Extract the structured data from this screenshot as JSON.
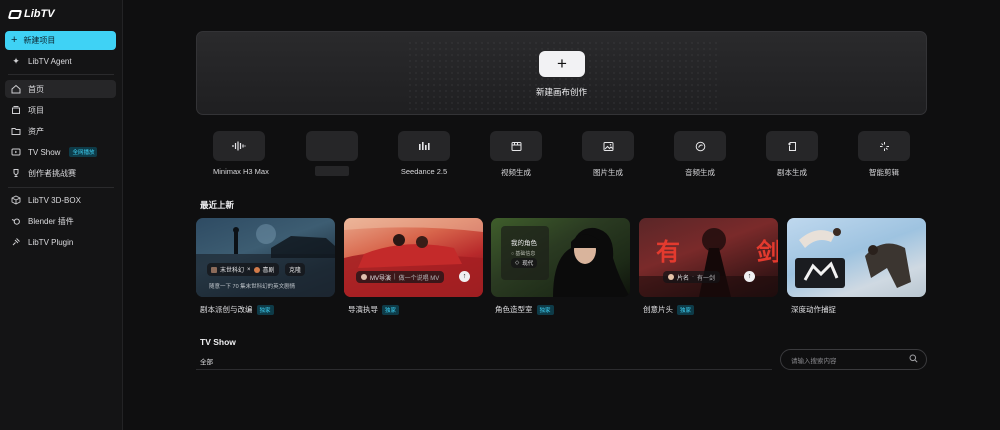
{
  "app": {
    "logo_text": "LibTV"
  },
  "sidebar": {
    "new_project": "新建项目",
    "items": [
      {
        "label": "LibTV Agent",
        "icon": "sparkle-icon"
      },
      {
        "label": "首页",
        "icon": "home-icon"
      },
      {
        "label": "项目",
        "icon": "stack-icon"
      },
      {
        "label": "资产",
        "icon": "folder-icon"
      },
      {
        "label": "TV Show",
        "icon": "tv-icon",
        "badge": "全网播放"
      },
      {
        "label": "创作者挑战赛",
        "icon": "trophy-icon"
      },
      {
        "label": "LibTV 3D-BOX",
        "icon": "cube-icon"
      },
      {
        "label": "Blender 插件",
        "icon": "blender-icon"
      },
      {
        "label": "LibTV Plugin",
        "icon": "plugin-icon"
      }
    ]
  },
  "hero": {
    "label": "新建画布创作",
    "plus": "+"
  },
  "tools": [
    {
      "label": "Minimax H3 Max",
      "icon": "waveform-icon"
    },
    {
      "label": "",
      "icon": ""
    },
    {
      "label": "Seedance 2.5",
      "icon": "bars-icon"
    },
    {
      "label": "视频生成",
      "icon": "video-icon"
    },
    {
      "label": "图片生成",
      "icon": "image-icon"
    },
    {
      "label": "音频生成",
      "icon": "audio-icon"
    },
    {
      "label": "剧本生成",
      "icon": "script-icon"
    },
    {
      "label": "智能剪辑",
      "icon": "cut-icon"
    }
  ],
  "recent": {
    "title": "最近上新",
    "cards": [
      {
        "caption": "剧本派创与改编",
        "badge": "独家",
        "chip1": "末世科幻",
        "chip2": "喜剧",
        "chip3": "克隆",
        "sub": "随意一下 70 集末世科幻的英文剧情"
      },
      {
        "caption": "导演执导",
        "badge": "独家",
        "chip1": "MV导演",
        "chip1_sub": "做一个说唱 MV"
      },
      {
        "caption": "角色造型室",
        "badge": "独家",
        "title": "我的角色",
        "line1": "基础信息",
        "chip1": "现代"
      },
      {
        "caption": "创意片头",
        "badge": "独家",
        "art": "有 剑",
        "chip1": "片名",
        "chip1_sub": "有一剑"
      },
      {
        "caption": "深度动作捕捉",
        "badge": ""
      }
    ]
  },
  "tvshow": {
    "title": "TV Show",
    "tab_all": "全部",
    "search_placeholder": "请输入搜索内容"
  },
  "colors": {
    "accent": "#3fd2f5",
    "background": "#0f0f10",
    "sidebar": "#141415"
  }
}
